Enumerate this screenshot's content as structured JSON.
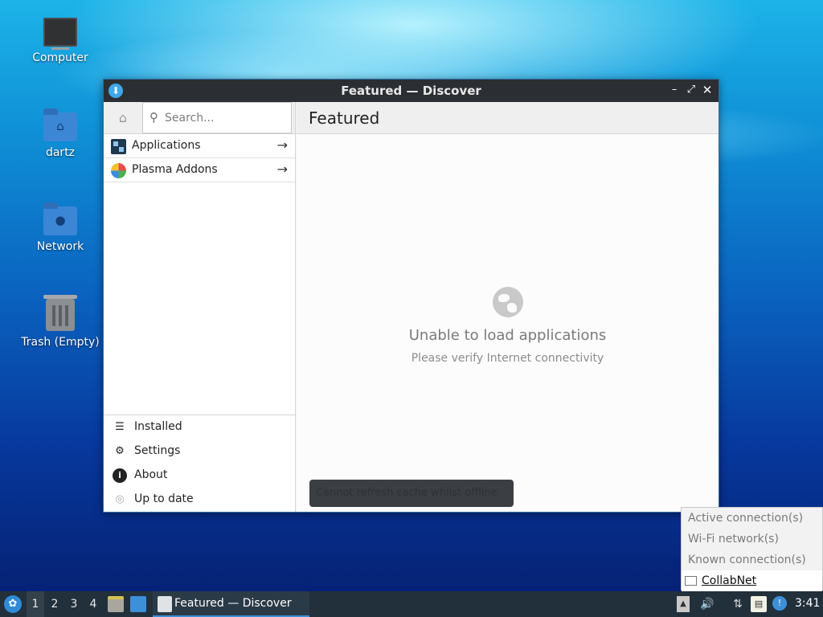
{
  "desktop": {
    "icons": [
      {
        "label": "Computer",
        "icon": "computer-icon"
      },
      {
        "label": "dartz",
        "icon": "home-folder-icon"
      },
      {
        "label": "Network",
        "icon": "network-folder-icon"
      },
      {
        "label": "Trash (Empty)",
        "icon": "trash-icon"
      }
    ]
  },
  "window": {
    "title": "Featured — Discover",
    "sidebar": {
      "search_placeholder": "Search...",
      "categories": [
        {
          "label": "Applications",
          "icon": "applications-icon"
        },
        {
          "label": "Plasma Addons",
          "icon": "plasma-addons-icon"
        }
      ],
      "bottom": [
        {
          "label": "Installed",
          "icon": "list-icon"
        },
        {
          "label": "Settings",
          "icon": "gear-icon"
        },
        {
          "label": "About",
          "icon": "info-icon"
        },
        {
          "label": "Up to date",
          "icon": "update-icon"
        }
      ]
    },
    "main": {
      "title": "Featured",
      "empty_title": "Unable to load applications",
      "empty_subtitle": "Please verify Internet connectivity",
      "toast": "Cannot refresh cache whilst offline"
    }
  },
  "network_popup": {
    "items": [
      "Active connection(s)",
      "Wi-Fi network(s)",
      "Known connection(s)"
    ],
    "connection": "CollabNet"
  },
  "taskbar": {
    "workspaces": [
      "1",
      "2",
      "3",
      "4"
    ],
    "active_workspace": "1",
    "task_label": "Featured — Discover",
    "clock": "3:41"
  },
  "colors": {
    "accent": "#3d8fd8",
    "titlebar": "#2b2f33",
    "taskbar": "#22303c"
  }
}
